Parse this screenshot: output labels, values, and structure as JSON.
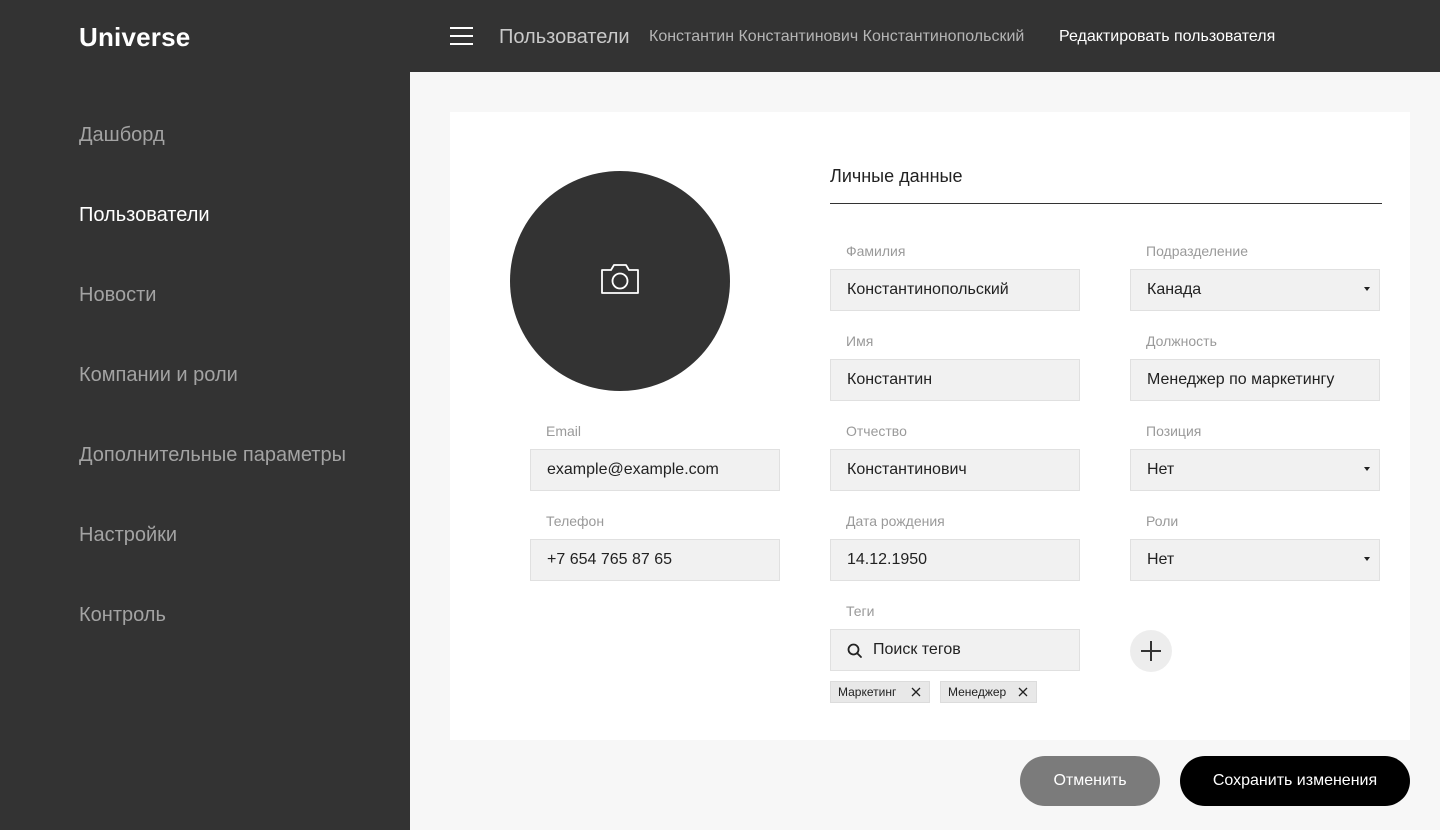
{
  "app": {
    "title": "Universe"
  },
  "header": {
    "breadcrumbs": [
      "Пользователи",
      "Константин Константинович Константинопольский",
      "Редактировать пользователя"
    ]
  },
  "sidebar": {
    "items": [
      {
        "label": "Дашборд",
        "active": false
      },
      {
        "label": "Пользователи",
        "active": true
      },
      {
        "label": "Новости",
        "active": false
      },
      {
        "label": "Компании и роли",
        "active": false
      },
      {
        "label": "Дополнительные параметры",
        "active": false
      },
      {
        "label": "Настройки",
        "active": false
      },
      {
        "label": "Контроль",
        "active": false
      }
    ]
  },
  "form": {
    "section_title": "Личные данные",
    "email": {
      "label": "Email",
      "value": "example@example.com"
    },
    "phone": {
      "label": "Телефон",
      "value": "+7 654 765 87 65"
    },
    "last_name": {
      "label": "Фамилия",
      "value": "Константинопольский"
    },
    "first_name": {
      "label": "Имя",
      "value": "Константин"
    },
    "patronymic": {
      "label": "Отчество",
      "value": "Константинович"
    },
    "birth_date": {
      "label": "Дата рождения",
      "value": "14.12.1950"
    },
    "department": {
      "label": "Подразделение",
      "value": "Канада"
    },
    "job_title": {
      "label": "Должность",
      "value": "Менеджер по маркетингу"
    },
    "position": {
      "label": "Позиция",
      "value": "Нет"
    },
    "roles": {
      "label": "Роли",
      "value": "Нет"
    },
    "tags": {
      "label": "Теги",
      "search_placeholder": "Поиск тегов",
      "items": [
        "Маркетинг",
        "Менеджер"
      ]
    }
  },
  "actions": {
    "cancel_label": "Отменить",
    "save_label": "Сохранить изменения"
  },
  "icons": {
    "menu": "menu-icon",
    "avatar_upload": "camera-icon",
    "search": "search-icon",
    "add": "plus-icon",
    "tag_remove": "close-icon",
    "dropdown": "chevron-down-icon"
  },
  "colors": {
    "dark": "#333333",
    "page_bg": "#f7f7f7",
    "field_bg": "#f1f1f1",
    "primary_button": "#000000",
    "secondary_button": "#7b7b7b"
  }
}
